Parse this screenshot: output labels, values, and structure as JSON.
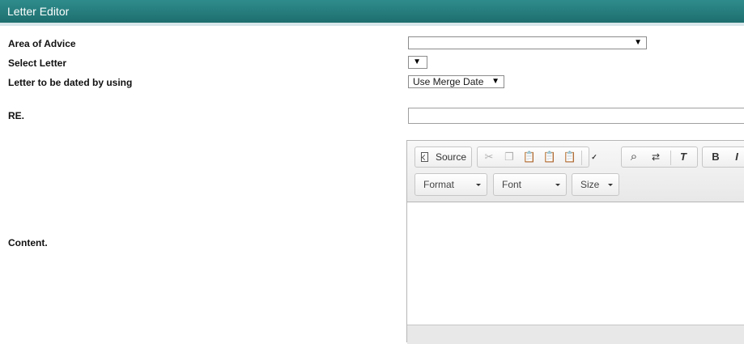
{
  "window": {
    "title": "Letter Editor"
  },
  "form": {
    "area_of_advice_label": "Area of Advice",
    "area_of_advice_value": "",
    "select_letter_label": "Select Letter",
    "select_letter_value": "",
    "dated_by_label": "Letter to be dated by using",
    "dated_by_value": "Use Merge Date",
    "re_label": "RE.",
    "re_value": "",
    "content_label": "Content."
  },
  "editor": {
    "source_label": "Source",
    "format_label": "Format",
    "font_label": "Font",
    "size_label": "Size",
    "bold_label": "B",
    "italic_label": "I"
  },
  "icons": {
    "dropdown": "dropdown-arrow-icon",
    "cut": "cut-icon",
    "copy": "copy-icon",
    "paste": "paste-icon",
    "paste_text": "paste-text-icon",
    "paste_word": "paste-word-icon",
    "spellcheck": "spellcheck-icon",
    "find": "search-icon",
    "replace": "replace-icon",
    "remove_format": "remove-format-icon"
  },
  "colors": {
    "titlebar": "#1e6e6e",
    "titlebar_text": "#ffffff"
  }
}
